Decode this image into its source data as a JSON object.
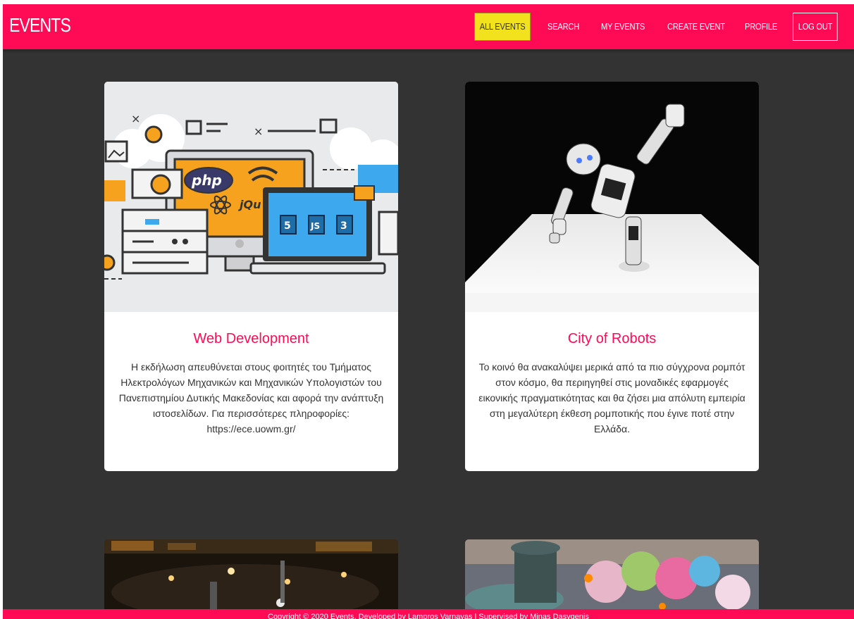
{
  "brand": "EVENTS",
  "nav": {
    "all_events": "ALL EVENTS",
    "search": "SEARCH",
    "my_events": "MY EVENTS",
    "create_event": "CREATE EVENT",
    "profile": "PROFILE",
    "logout": "LOG OUT"
  },
  "events": [
    {
      "title": "Web Development",
      "description": "Η εκδήλωση απευθύνεται στους φοιτητές του Τμήματος Ηλεκτρολόγων Μηχανικών και Μηχανικών Υπολογιστών του Πανεπιστημίου Δυτικής Μακεδονίας και αφορά την ανάπτυξη ιστοσελίδων. Για περισσότερες πληροφορίες: https://ece.uowm.gr/"
    },
    {
      "title": "City of Robots",
      "description": "Το κοινό θα ανακαλύψει μερικά από τα πιο σύγχρονα ρομπότ στον κόσμο, θα περιηγηθεί στις μοναδικές εφαρμογές εικονικής πραγματικότητας και θα ζήσει μια απόλυτη εμπειρία στη μεγαλύτερη έκθεση ρομποτικής που έγινε ποτέ στην Ελλάδα."
    }
  ],
  "footer": "Copyright © 2020 Events. Developed by Lampros Varnavas | Supervised by Minas Dasygenis",
  "colors": {
    "brand": "#ff0a55",
    "background": "#333333",
    "active_nav": "#f2e21d"
  }
}
